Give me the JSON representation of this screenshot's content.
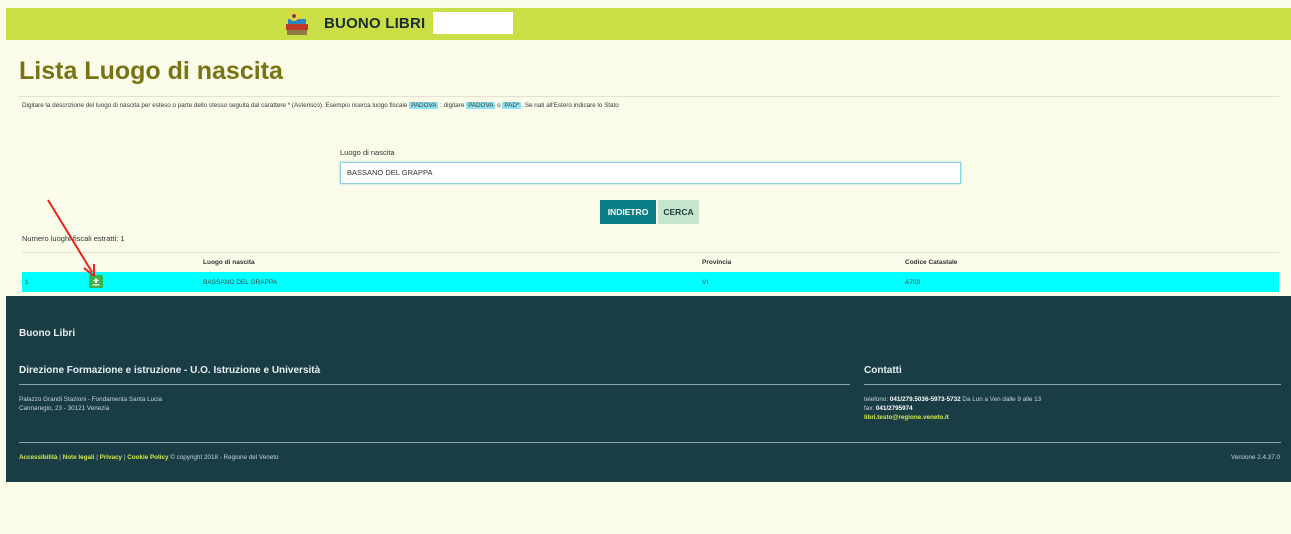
{
  "header": {
    "app_title": "BUONO LIBRI",
    "accent_color": "#c9df45"
  },
  "main": {
    "page_title": "Lista Luogo di nascita",
    "instructions": {
      "part1": "Digitare la descrizione del luogo di nascita per esteso o parte dello stesso seguita dal carattere * (Asterisco). Esempio ricerca luogo fiscale ",
      "example1": "PADOVA",
      "part2": " : digitare ",
      "example2": "PADOVA",
      "part3": " o ",
      "example3": "PAD*",
      "part4": ". Se nati all'Estero indicare lo Stato"
    },
    "field_label": "Luogo di nascita",
    "field_value": "BASSANO DEL GRAPPA",
    "buttons": {
      "back": "INDIETRO",
      "search": "CERCA"
    },
    "count_text": "Numero luoghi fiscali estratti: 1"
  },
  "table": {
    "headers": [
      "Luogo di nascita",
      "Provincia",
      "Codice Catastale"
    ],
    "rows": [
      {
        "index": "1",
        "luogo": "BASSANO DEL GRAPPA",
        "provincia": "VI",
        "codice": "A703"
      }
    ],
    "selected_row_color": "#00ffff"
  },
  "footer": {
    "brand": "Buono Libri",
    "department": "Direzione Formazione e istruzione - U.O. Istruzione e Università",
    "address_line1": "Palazzo Grandi Stazioni - Fondamenta Santa Lucia",
    "address_line2": "Cannaregio, 23 - 30121 Venezia",
    "contacts_title": "Contatti",
    "phone_label": "telefono: ",
    "phone": "041/279.5036-5973-5732",
    "phone_hours": " Da Lun a Ven dalle 9 alle 13",
    "fax_label": "fax: ",
    "fax": "041/2795974",
    "email": "libri.testo@regione.veneto.it",
    "links": [
      "Accessibilità",
      "Note legali",
      "Privacy",
      "Cookie Policy"
    ],
    "link_separator": " | ",
    "copyright": " © copyright 2018 - Regione del Veneto",
    "version": "Versione 2.4.37.0",
    "bg_color": "#1a3d45"
  },
  "icons": {
    "logo": "books-logo-icon",
    "select": "select-row-icon",
    "annotation": "red-arrow-annotation"
  }
}
